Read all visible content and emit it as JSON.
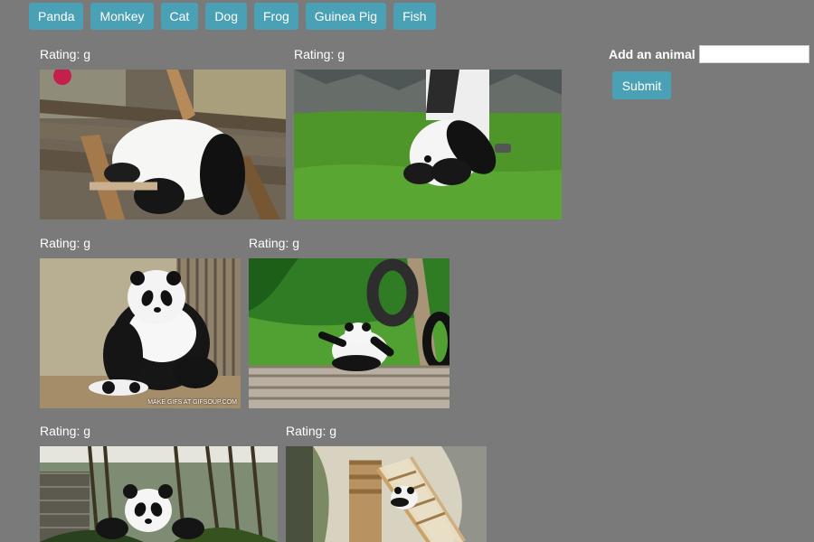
{
  "buttons": [
    {
      "label": "Panda"
    },
    {
      "label": "Monkey"
    },
    {
      "label": "Cat"
    },
    {
      "label": "Dog"
    },
    {
      "label": "Frog"
    },
    {
      "label": "Guinea Pig"
    },
    {
      "label": "Fish"
    }
  ],
  "gifs": [
    {
      "rating": "Rating: g"
    },
    {
      "rating": "Rating: g"
    },
    {
      "rating": "Rating: g"
    },
    {
      "rating": "Rating: g",
      "watermark": "MAKE GIFS AT GIFSOUP.COM"
    },
    {
      "rating": "Rating: g"
    },
    {
      "rating": "Rating: g"
    }
  ],
  "form": {
    "label": "Add an animal",
    "input_value": "",
    "input_placeholder": "",
    "submit_label": "Submit"
  },
  "colors": {
    "page_background": "#7a7a7a",
    "button": "#4aa1b5",
    "text": "#ffffff"
  }
}
